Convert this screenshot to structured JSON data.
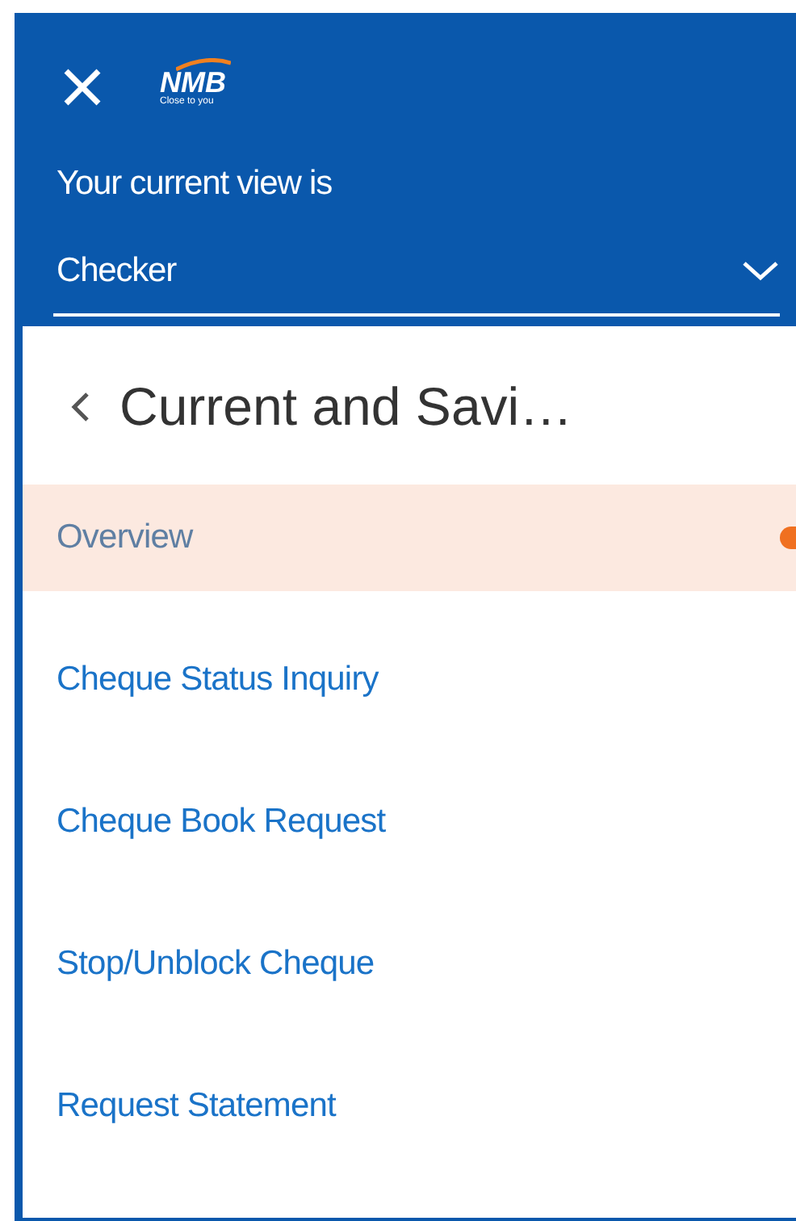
{
  "header": {
    "logo": {
      "name": "NMB",
      "tagline": "Close to you"
    },
    "view_label": "Your current view is",
    "view_select": {
      "value": "Checker"
    }
  },
  "menu": {
    "back_title": "Current and Savi…",
    "items": [
      {
        "label": "Overview",
        "selected": true
      },
      {
        "label": "Cheque Status Inquiry",
        "selected": false
      },
      {
        "label": "Cheque Book Request",
        "selected": false
      },
      {
        "label": "Stop/Unblock Cheque",
        "selected": false
      },
      {
        "label": "Request Statement",
        "selected": false
      }
    ]
  }
}
